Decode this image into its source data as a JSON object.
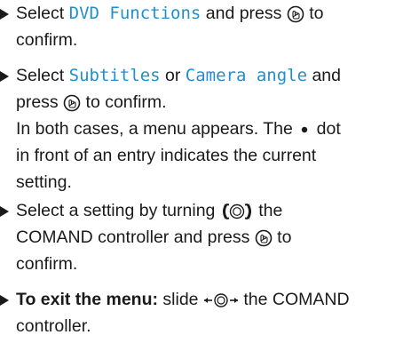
{
  "steps": [
    {
      "prefix": "Select ",
      "term": "DVD Functions",
      "after": " and press ",
      "confirm": " to",
      "line2": "confirm."
    },
    {
      "prefix": "Select ",
      "term1": "Subtitles",
      "mid": " or ",
      "term2": "Camera angle",
      "after": " and",
      "line2a": "press ",
      "line2b": " to confirm.",
      "note1a": "In both cases, a menu appears. The ",
      "note1b": " dot",
      "note2": "in front of an entry indicates the current",
      "note3": "setting."
    },
    {
      "prefix": "Select a setting by turning ",
      "after": " the",
      "line2a": "COMAND controller and press ",
      "line2b": " to",
      "line3": "confirm."
    },
    {
      "bold": "To exit the menu:",
      "after": " slide ",
      "after2": " the COMAND",
      "line2": "controller."
    }
  ],
  "icons": {
    "press": "press-controller-icon",
    "turn": "turn-controller-icon",
    "slide": "slide-left-right-controller-icon",
    "dot": "bullet-dot-icon"
  }
}
